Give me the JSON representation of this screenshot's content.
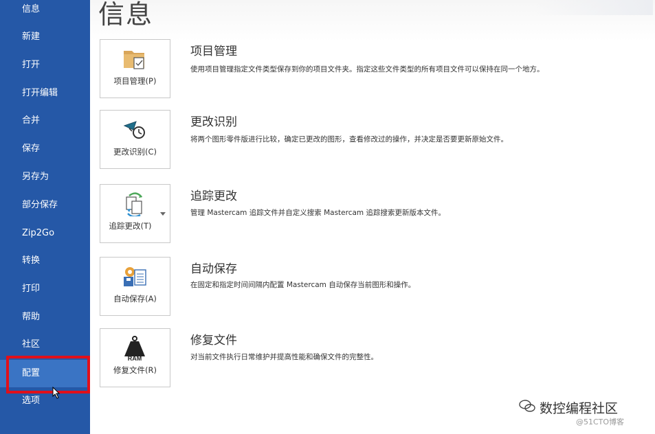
{
  "sidebar": {
    "items": [
      {
        "label": "信息"
      },
      {
        "label": "新建"
      },
      {
        "label": "打开"
      },
      {
        "label": "打开编辑"
      },
      {
        "label": "合并"
      },
      {
        "label": "保存"
      },
      {
        "label": "另存为"
      },
      {
        "label": "部分保存"
      },
      {
        "label": "Zip2Go"
      },
      {
        "label": "转换"
      },
      {
        "label": "打印"
      },
      {
        "label": "帮助"
      },
      {
        "label": "社区"
      },
      {
        "label": "配置"
      },
      {
        "label": "选项"
      }
    ]
  },
  "main": {
    "title": "信息",
    "entries": [
      {
        "button_label": "项目管理(P)",
        "title": "项目管理",
        "description": "使用项目管理指定文件类型保存到你的项目文件夹。指定这些文件类型的所有项目文件可以保持在同一个地方。",
        "icon": "project-folder-icon"
      },
      {
        "button_label": "更改识别(C)",
        "title": "更改识别",
        "description": "将两个图形零件版进行比较，确定已更改的图形，查看修改过的操作，并决定是否要更新原始文件。",
        "icon": "change-recognition-icon"
      },
      {
        "button_label": "追踪更改(T)",
        "title": "追踪更改",
        "description": "管理 Mastercam 追踪文件并自定义搜索 Mastercam 追踪搜索更新版本文件。",
        "icon": "track-changes-icon"
      },
      {
        "button_label": "自动保存(A)",
        "title": "自动保存",
        "description": "在固定和指定时间间隔内配置 Mastercam 自动保存当前图形和操作。",
        "icon": "autosave-icon"
      },
      {
        "button_label": "修复文件(R)",
        "title": "修复文件",
        "description": "对当前文件执行日常维护并提高性能和确保文件的完整性。",
        "icon": "ram-weight-icon",
        "icon_text": "RAM"
      }
    ]
  },
  "watermark": {
    "text": "数控编程社区",
    "subtext": "@51CTO博客"
  },
  "colors": {
    "sidebar": "#2558a7",
    "active_item": "#3a74c4",
    "highlight": "#e0101a"
  }
}
